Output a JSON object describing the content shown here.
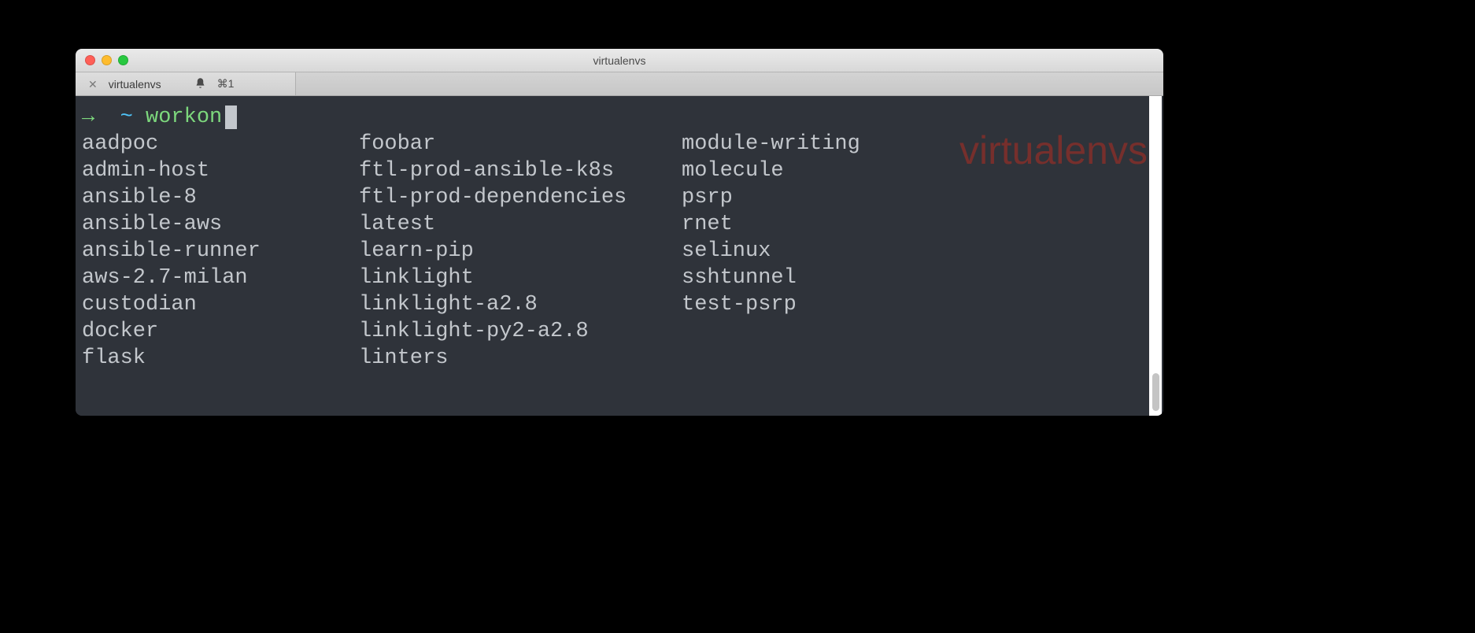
{
  "window": {
    "title": "virtualenvs"
  },
  "tab": {
    "title": "virtualenvs",
    "shortcut": "⌘1"
  },
  "prompt": {
    "arrow": "→",
    "tilde": "~",
    "command": "workon"
  },
  "watermark": "virtualenvs",
  "columns": [
    [
      "aadpoc",
      "admin-host",
      "ansible-8",
      "ansible-aws",
      "ansible-runner",
      "aws-2.7-milan",
      "custodian",
      "docker",
      "flask"
    ],
    [
      "foobar",
      "ftl-prod-ansible-k8s",
      "ftl-prod-dependencies",
      "latest",
      "learn-pip",
      "linklight",
      "linklight-a2.8",
      "linklight-py2-a2.8",
      "linters"
    ],
    [
      "module-writing",
      "molecule",
      "psrp",
      "rnet",
      "selinux",
      "sshtunnel",
      "test-psrp"
    ]
  ]
}
